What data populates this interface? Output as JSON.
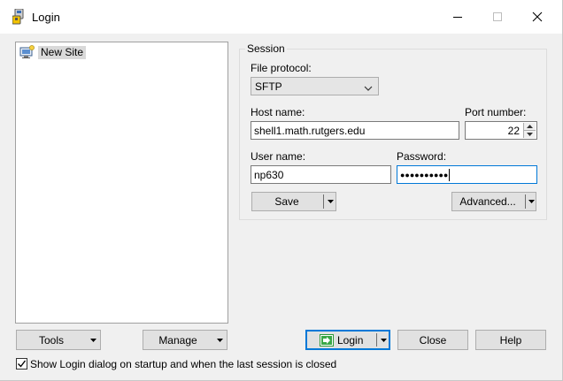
{
  "window": {
    "title": "Login",
    "icon": "winscp-app-icon",
    "controls": [
      "minimize-icon",
      "maximize-icon",
      "close-icon"
    ]
  },
  "sites": {
    "items": [
      {
        "label": "New Site",
        "icon": "new-site-computer-icon"
      }
    ]
  },
  "session": {
    "group_label": "Session",
    "file_protocol_label": "File protocol:",
    "file_protocol_value": "SFTP",
    "host_name_label": "Host name:",
    "host_name_value": "shell1.math.rutgers.edu",
    "port_label": "Port number:",
    "port_value": "22",
    "user_name_label": "User name:",
    "user_name_value": "np630",
    "password_label": "Password:",
    "password_masked": "●●●●●●●●●●",
    "save_label": "Save",
    "advanced_label": "Advanced..."
  },
  "bottom": {
    "tools_label": "Tools",
    "manage_label": "Manage",
    "login_label": "Login",
    "close_label": "Close",
    "help_label": "Help",
    "show_login_label": "Show Login dialog on startup and when the last session is closed",
    "show_login_checked": true
  },
  "colors": {
    "focus_accent": "#0078d7",
    "login_icon_green": "#2e9a3a",
    "selection_gray": "#d9d9d9"
  }
}
